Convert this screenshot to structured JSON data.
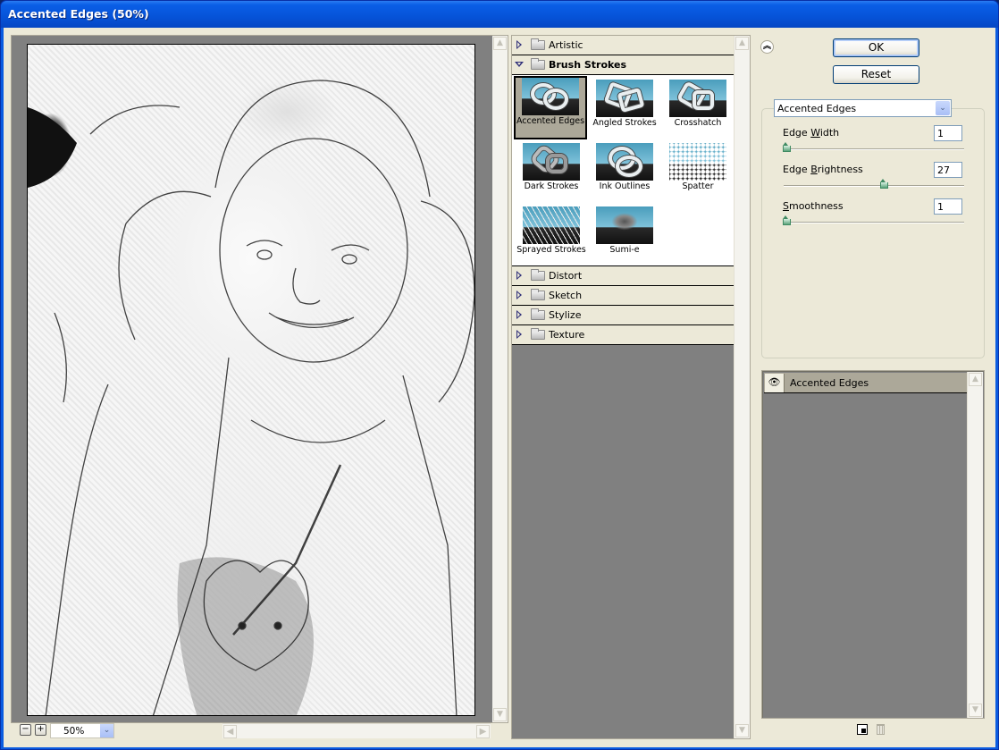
{
  "window": {
    "title": "Accented Edges (50%)"
  },
  "preview": {
    "zoom_level": "50%",
    "zoom_out_label": "−",
    "zoom_in_label": "+"
  },
  "filter_browser": {
    "categories": [
      {
        "label": "Artistic",
        "expanded": false
      },
      {
        "label": "Brush Strokes",
        "expanded": true
      },
      {
        "label": "Distort",
        "expanded": false
      },
      {
        "label": "Sketch",
        "expanded": false
      },
      {
        "label": "Stylize",
        "expanded": false
      },
      {
        "label": "Texture",
        "expanded": false
      }
    ],
    "brush_strokes_filters": [
      {
        "label": "Accented Edges",
        "selected": true
      },
      {
        "label": "Angled Strokes",
        "selected": false
      },
      {
        "label": "Crosshatch",
        "selected": false
      },
      {
        "label": "Dark Strokes",
        "selected": false
      },
      {
        "label": "Ink Outlines",
        "selected": false
      },
      {
        "label": "Spatter",
        "selected": false
      },
      {
        "label": "Sprayed Strokes",
        "selected": false
      },
      {
        "label": "Sumi-e",
        "selected": false
      }
    ]
  },
  "buttons": {
    "ok": "OK",
    "reset": "Reset"
  },
  "settings": {
    "selected_filter": "Accented Edges",
    "params": [
      {
        "label_pre": "Edge ",
        "label_mnemonic": "W",
        "label_post": "idth",
        "value": "1",
        "min": 1,
        "max": 14,
        "slider_fraction": 0.0
      },
      {
        "label_pre": "Edge ",
        "label_mnemonic": "B",
        "label_post": "rightness",
        "value": "27",
        "min": 0,
        "max": 50,
        "slider_fraction": 0.54
      },
      {
        "label_pre": "",
        "label_mnemonic": "S",
        "label_post": "moothness",
        "value": "1",
        "min": 1,
        "max": 15,
        "slider_fraction": 0.0
      }
    ]
  },
  "effect_layers": {
    "items": [
      {
        "label": "Accented Edges",
        "visible": true
      }
    ]
  },
  "icons": {
    "collapse": "double-chevron-up-icon",
    "dropdown": "chevron-down-icon",
    "scroll_up": "▲",
    "scroll_down": "▼",
    "scroll_left": "◀",
    "scroll_right": "▶",
    "eye": "👁",
    "collapse_glyph": "︽",
    "dropdown_glyph": "⌄"
  }
}
